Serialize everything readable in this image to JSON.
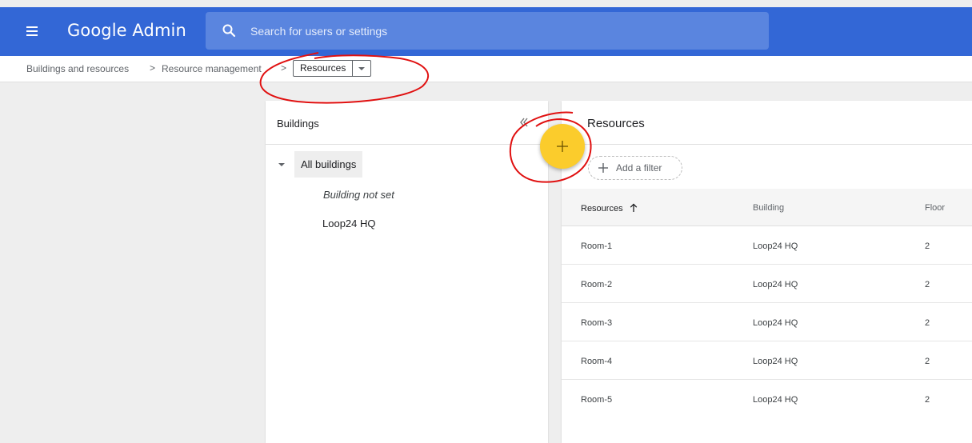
{
  "app": {
    "title": "Google Admin",
    "icons": {
      "menu": "hamburger-menu-icon",
      "search": "search-icon"
    },
    "colors": {
      "topbar": "#3367d6",
      "search_box": "#5a85df",
      "fab": "#fbcc2c",
      "annotation": "#e01010"
    }
  },
  "search": {
    "placeholder": "Search for users or settings",
    "value": ""
  },
  "breadcrumb": {
    "items": [
      "Buildings and resources",
      "Resource management"
    ],
    "separator": ">",
    "current": "Resources"
  },
  "buildings_panel": {
    "title": "Buildings",
    "root": "All buildings",
    "children": [
      "Building not set",
      "Loop24 HQ"
    ]
  },
  "resources_panel": {
    "title": "Resources",
    "filter_label": "Add a filter",
    "fab_icon": "plus-icon",
    "columns": [
      "Resources",
      "Building",
      "Floor"
    ],
    "sorted_column": "Resources",
    "rows": [
      {
        "name": "Room-1",
        "building": "Loop24 HQ",
        "floor": "2"
      },
      {
        "name": "Room-2",
        "building": "Loop24 HQ",
        "floor": "2"
      },
      {
        "name": "Room-3",
        "building": "Loop24 HQ",
        "floor": "2"
      },
      {
        "name": "Room-4",
        "building": "Loop24 HQ",
        "floor": "2"
      },
      {
        "name": "Room-5",
        "building": "Loop24 HQ",
        "floor": "2"
      }
    ]
  }
}
